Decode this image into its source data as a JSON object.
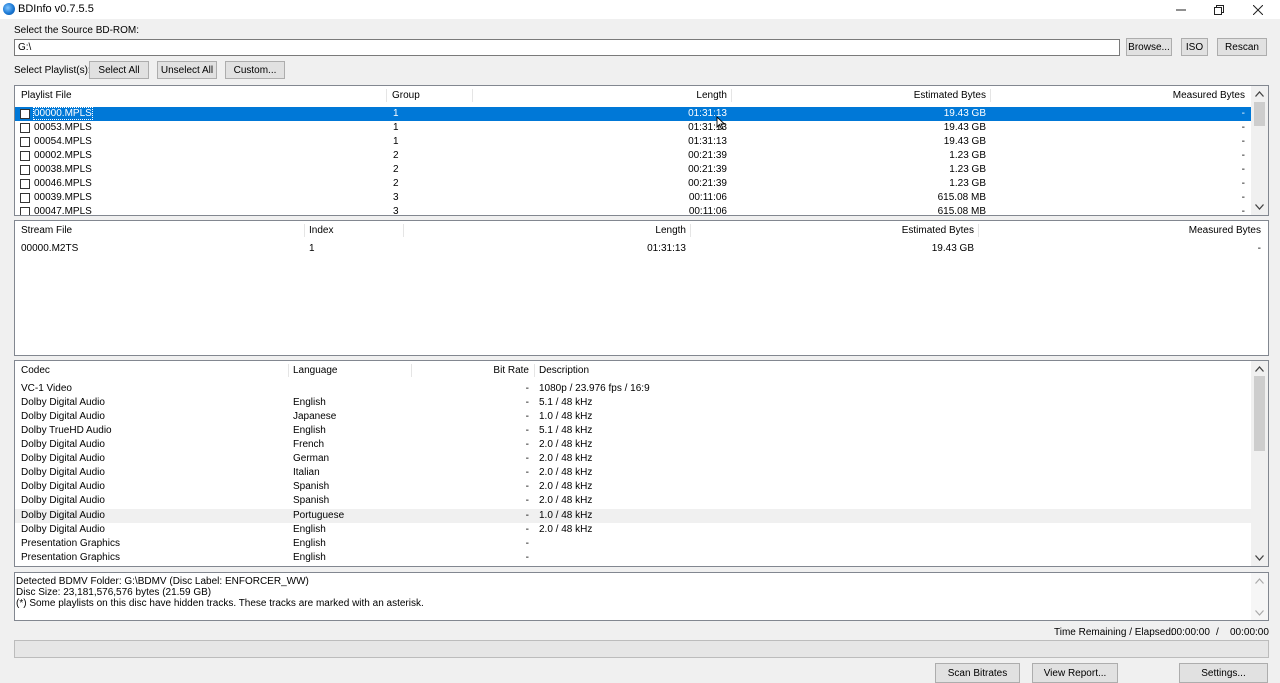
{
  "window": {
    "title": "BDInfo v0.7.5.5"
  },
  "source": {
    "label": "Select the Source BD-ROM:",
    "path": "G:\\",
    "browse": "Browse...",
    "iso": "ISO",
    "rescan": "Rescan"
  },
  "playlist_select": {
    "label": "Select Playlist(s):",
    "select_all": "Select All",
    "unselect_all": "Unselect All",
    "custom": "Custom..."
  },
  "playlists": {
    "headers": {
      "file": "Playlist File",
      "group": "Group",
      "length": "Length",
      "estimated": "Estimated Bytes",
      "measured": "Measured Bytes"
    },
    "rows": [
      {
        "file": "00000.MPLS",
        "group": "1",
        "length": "01:31:13",
        "estimated": "19.43 GB",
        "measured": "-"
      },
      {
        "file": "00053.MPLS",
        "group": "1",
        "length": "01:31:13",
        "estimated": "19.43 GB",
        "measured": "-"
      },
      {
        "file": "00054.MPLS",
        "group": "1",
        "length": "01:31:13",
        "estimated": "19.43 GB",
        "measured": "-"
      },
      {
        "file": "00002.MPLS",
        "group": "2",
        "length": "00:21:39",
        "estimated": "1.23 GB",
        "measured": "-"
      },
      {
        "file": "00038.MPLS",
        "group": "2",
        "length": "00:21:39",
        "estimated": "1.23 GB",
        "measured": "-"
      },
      {
        "file": "00046.MPLS",
        "group": "2",
        "length": "00:21:39",
        "estimated": "1.23 GB",
        "measured": "-"
      },
      {
        "file": "00039.MPLS",
        "group": "3",
        "length": "00:11:06",
        "estimated": "615.08 MB",
        "measured": "-"
      },
      {
        "file": "00047.MPLS",
        "group": "3",
        "length": "00:11:06",
        "estimated": "615.08 MB",
        "measured": "-"
      }
    ]
  },
  "streams": {
    "headers": {
      "file": "Stream File",
      "index": "Index",
      "length": "Length",
      "estimated": "Estimated Bytes",
      "measured": "Measured Bytes"
    },
    "rows": [
      {
        "file": "00000.M2TS",
        "index": "1",
        "length": "01:31:13",
        "estimated": "19.43 GB",
        "measured": "-"
      }
    ]
  },
  "codecs": {
    "headers": {
      "codec": "Codec",
      "language": "Language",
      "bitrate": "Bit Rate",
      "description": "Description"
    },
    "rows": [
      {
        "codec": "VC-1 Video",
        "language": "",
        "bitrate": "-",
        "description": "1080p / 23.976 fps / 16:9"
      },
      {
        "codec": "Dolby Digital Audio",
        "language": "English",
        "bitrate": "-",
        "description": "5.1 / 48 kHz"
      },
      {
        "codec": "Dolby Digital Audio",
        "language": "Japanese",
        "bitrate": "-",
        "description": "1.0 / 48 kHz"
      },
      {
        "codec": "Dolby TrueHD Audio",
        "language": "English",
        "bitrate": "-",
        "description": "5.1 / 48 kHz"
      },
      {
        "codec": "Dolby Digital Audio",
        "language": "French",
        "bitrate": "-",
        "description": "2.0 / 48 kHz"
      },
      {
        "codec": "Dolby Digital Audio",
        "language": "German",
        "bitrate": "-",
        "description": "2.0 / 48 kHz"
      },
      {
        "codec": "Dolby Digital Audio",
        "language": "Italian",
        "bitrate": "-",
        "description": "2.0 / 48 kHz"
      },
      {
        "codec": "Dolby Digital Audio",
        "language": "Spanish",
        "bitrate": "-",
        "description": "2.0 / 48 kHz"
      },
      {
        "codec": "Dolby Digital Audio",
        "language": "Spanish",
        "bitrate": "-",
        "description": "2.0 / 48 kHz"
      },
      {
        "codec": "Dolby Digital Audio",
        "language": "Portuguese",
        "bitrate": "-",
        "description": "1.0 / 48 kHz"
      },
      {
        "codec": "Dolby Digital Audio",
        "language": "English",
        "bitrate": "-",
        "description": "2.0 / 48 kHz"
      },
      {
        "codec": "Presentation Graphics",
        "language": "English",
        "bitrate": "-",
        "description": ""
      },
      {
        "codec": "Presentation Graphics",
        "language": "English",
        "bitrate": "-",
        "description": ""
      }
    ]
  },
  "status": {
    "line1": "Detected BDMV Folder: G:\\BDMV (Disc Label: ENFORCER_WW)",
    "line2": "Disc Size: 23,181,576,576 bytes (21.59 GB)",
    "line3": "(*) Some playlists on this disc have hidden tracks. These tracks are marked with an asterisk."
  },
  "timer": {
    "label": "Time Remaining / Elapsed:",
    "remaining": "00:00:00",
    "separator": "/",
    "elapsed": "00:00:00"
  },
  "progress": {
    "value": 0
  },
  "buttons": {
    "scan": "Scan Bitrates",
    "report": "View Report...",
    "settings": "Settings..."
  },
  "colors": {
    "selection": "#0078d7",
    "background": "#f0f0f0"
  }
}
